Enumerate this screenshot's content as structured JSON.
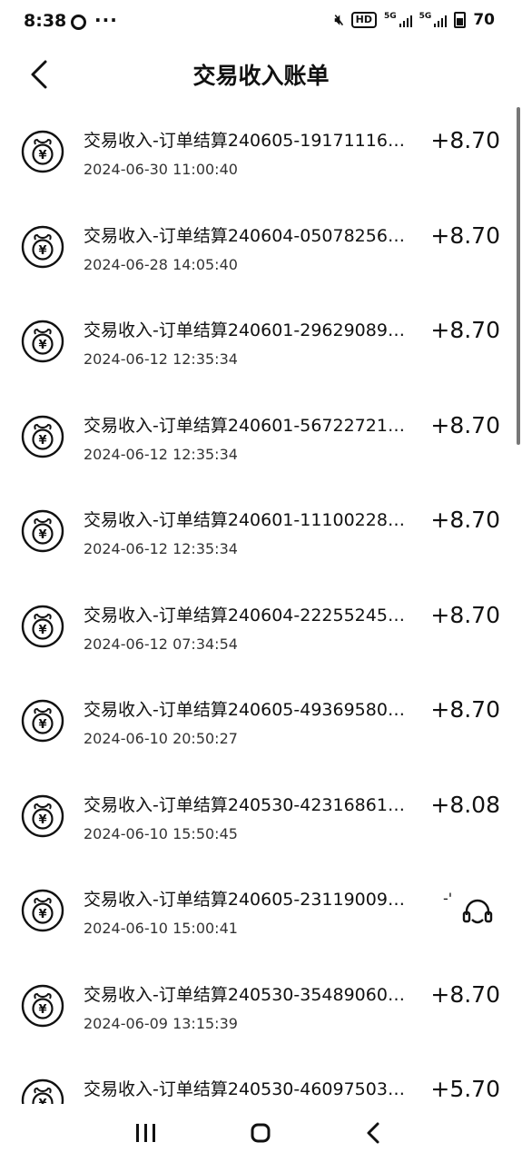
{
  "status_bar": {
    "time": "8:38",
    "dots": "···",
    "battery": "70",
    "hd": "HD",
    "network": "5G"
  },
  "header": {
    "title": "交易收入账单"
  },
  "transactions": [
    {
      "name": "交易收入-订单结算240605-19171116…",
      "time": "2024-06-30 11:00:40",
      "amount": "+8.70"
    },
    {
      "name": "交易收入-订单结算240604-05078256…",
      "time": "2024-06-28 14:05:40",
      "amount": "+8.70"
    },
    {
      "name": "交易收入-订单结算240601-29629089…",
      "time": "2024-06-12 12:35:34",
      "amount": "+8.70"
    },
    {
      "name": "交易收入-订单结算240601-56722721…",
      "time": "2024-06-12 12:35:34",
      "amount": "+8.70"
    },
    {
      "name": "交易收入-订单结算240601-11100228…",
      "time": "2024-06-12 12:35:34",
      "amount": "+8.70"
    },
    {
      "name": "交易收入-订单结算240604-22255245…",
      "time": "2024-06-12 07:34:54",
      "amount": "+8.70"
    },
    {
      "name": "交易收入-订单结算240605-49369580…",
      "time": "2024-06-10 20:50:27",
      "amount": "+8.70"
    },
    {
      "name": "交易收入-订单结算240530-42316861…",
      "time": "2024-06-10 15:50:45",
      "amount": "+8.08"
    },
    {
      "name": "交易收入-订单结算240605-23119009…",
      "time": "2024-06-10 15:00:41",
      "amount": ""
    },
    {
      "name": "交易收入-订单结算240530-35489060…",
      "time": "2024-06-09 13:15:39",
      "amount": "+8.70"
    },
    {
      "name": "交易收入-订单结算240530-46097503…",
      "time": "",
      "amount": "+5.70"
    }
  ],
  "customer_service": {
    "mark": "-'"
  },
  "icons": {
    "income": "yuan-coin-icon",
    "back": "back-arrow-icon",
    "support": "headset-icon",
    "nav_recent": "recent-apps-icon",
    "nav_home": "home-icon",
    "nav_back": "nav-back-icon"
  }
}
